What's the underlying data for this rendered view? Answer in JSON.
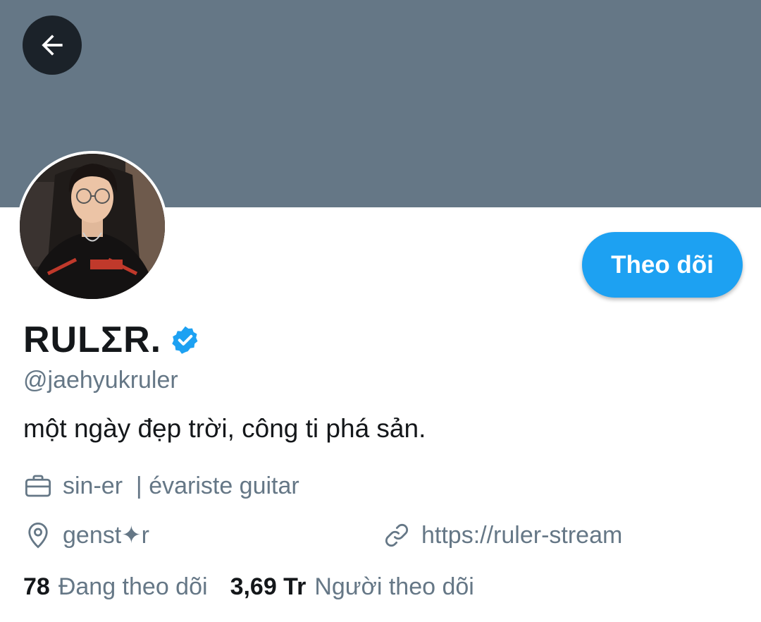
{
  "header": {
    "banner_color": "#657786",
    "back_icon": "arrow-left-icon"
  },
  "profile": {
    "avatar_icon": "avatar-photo",
    "follow_label": "Theo dõi",
    "display_name": "RULΣR.",
    "verified_icon": "verified-badge-icon",
    "handle": "@jaehyukruler",
    "bio": "một ngày đẹp trời, công ti phá sản.",
    "profession_icon": "briefcase-icon",
    "profession": "sin-er  | évariste guitar",
    "location_icon": "location-pin-icon",
    "location": "genst✦r",
    "link_icon": "link-icon",
    "link": "https://ruler-stream"
  },
  "stats": {
    "following_count": "78",
    "following_label": "Đang theo dõi",
    "followers_count": "3,69 Tr",
    "followers_label": "Người theo dõi"
  },
  "colors": {
    "accent": "#1da1f2",
    "secondary_text": "#657786",
    "primary_text": "#14171a"
  }
}
